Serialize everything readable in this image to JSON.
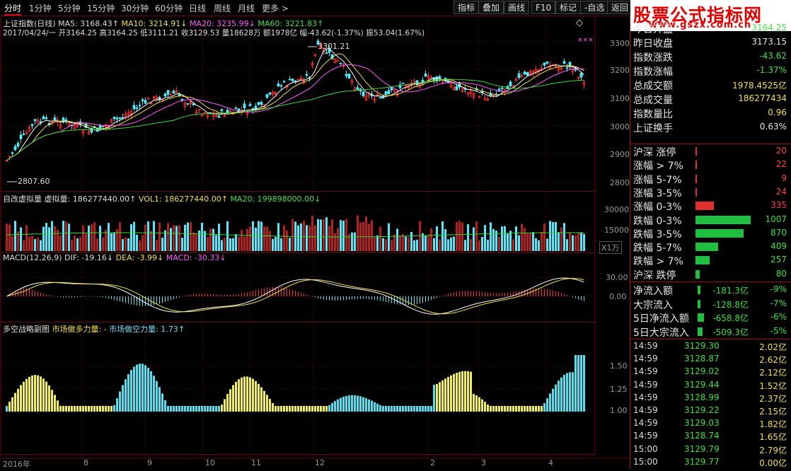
{
  "toolbar": {
    "tabs": [
      "分时",
      "1分钟",
      "5分钟",
      "15分钟",
      "30分钟",
      "60分钟",
      "日线",
      "周线",
      "月线",
      "更多 >"
    ],
    "buttons": [
      "指标",
      "叠加",
      "画线",
      "F10",
      "标记",
      "-自选",
      "返回"
    ]
  },
  "logo": {
    "line1": "股票公式指标网",
    "line2": "www.gszx.com.cn"
  },
  "main": {
    "title": "上证指数(日线)",
    "ma5": "MA5: 3168.43↑",
    "ma10": "MA10: 3214.91↓",
    "ma20": "MA20: 3235.99↓",
    "ma60": "MA60: 3221.83↑",
    "ohlc": "2017/04/24/一 开3164.25 高3164.25 低3111.21 收3129.53 量18628万 额1978亿 幅-43.62(-1.37%) 振53.04(1.67%)",
    "high_label": "3301.21",
    "low_label": "2807.60",
    "y_ticks": [
      "3300",
      "3200",
      "3100",
      "3000",
      "2900",
      "2800"
    ],
    "xxx": "×××"
  },
  "volume": {
    "title": "自改虚拟量",
    "v1": "虚拟量: 186277440.00↑",
    "v2": "VOL1: 186277440.00↑",
    "v3": "MA20: 199898000.00↓",
    "y_ticks": [
      "30000",
      "15000"
    ],
    "unit": "X1万"
  },
  "macd": {
    "title": "MACD(12,26,9)",
    "dif": "DIF: -19.16↓",
    "dea": "DEA: -3.99↓",
    "macd": "MACD: -30.33↓",
    "y_ticks": [
      "30.00",
      "0.00"
    ]
  },
  "strategy": {
    "title": "多空战略副图",
    "bull": "市场做多力量: -",
    "bear": "市场做空力量: 1.73↑",
    "y_ticks": [
      "1.50",
      "1.25",
      "1.00"
    ]
  },
  "x_labels": [
    "2016年",
    "8",
    "9",
    "10",
    "11",
    "12",
    "2",
    "3",
    "4"
  ],
  "quote": {
    "rows": [
      {
        "label": "今日开盘",
        "value": "3164.25",
        "color": "#4be04b"
      },
      {
        "label": "昨日收盘",
        "value": "3173.15",
        "color": "#e8e8e8"
      },
      {
        "label": "指数涨跌",
        "value": "-43.62",
        "color": "#4be04b"
      },
      {
        "label": "指数涨幅",
        "value": "-1.37%",
        "color": "#4be04b"
      },
      {
        "label": "总成交额",
        "value": "1978.4525亿",
        "color": "#f0e050"
      },
      {
        "label": "总成交量",
        "value": "186277434",
        "color": "#f0e050"
      },
      {
        "label": "指数量比",
        "value": "0.96",
        "color": "#f0e050"
      },
      {
        "label": "上证换手",
        "value": "0.63%",
        "color": "#e8e8e8"
      }
    ]
  },
  "breadth": [
    {
      "label": "沪深 涨停",
      "value": "20",
      "color": "#e03030",
      "bar": 1
    },
    {
      "label": "涨幅 > 7%",
      "value": "22",
      "color": "#e03030",
      "bar": 1
    },
    {
      "label": "涨幅 5-7%",
      "value": "9",
      "color": "#e03030",
      "bar": 1
    },
    {
      "label": "涨幅 3-5%",
      "value": "24",
      "color": "#e03030",
      "bar": 1
    },
    {
      "label": "涨幅 0-3%",
      "value": "335",
      "color": "#e03030",
      "bar": 26
    },
    {
      "label": "跌幅 0-3%",
      "value": "1007",
      "color": "#1fc040",
      "bar": 78
    },
    {
      "label": "跌幅 3-5%",
      "value": "870",
      "color": "#1fc040",
      "bar": 68
    },
    {
      "label": "跌幅 5-7%",
      "value": "409",
      "color": "#1fc040",
      "bar": 32
    },
    {
      "label": "跌幅 > 7%",
      "value": "257",
      "color": "#1fc040",
      "bar": 20
    },
    {
      "label": "沪深 跌停",
      "value": "80",
      "color": "#1fc040",
      "bar": 6
    }
  ],
  "flows": [
    {
      "label": "净流入额",
      "value": "-181.3亿",
      "pct": "-9%",
      "bar": 6
    },
    {
      "label": "大宗流入",
      "value": "-128.8亿",
      "pct": "-7%",
      "bar": 5
    },
    {
      "label": "5日净流入额",
      "value": "-658.8亿",
      "pct": "-6%",
      "bar": 26
    },
    {
      "label": "5日大宗流入",
      "value": "-509.3亿",
      "pct": "-5%",
      "bar": 20
    }
  ],
  "ticks": [
    {
      "time": "14:59",
      "price": "3129.30",
      "vol": "2.02亿"
    },
    {
      "time": "14:59",
      "price": "3128.87",
      "vol": "2.62亿"
    },
    {
      "time": "14:59",
      "price": "3129.02",
      "vol": "2.12亿"
    },
    {
      "time": "14:59",
      "price": "3129.44",
      "vol": "1.52亿"
    },
    {
      "time": "14:59",
      "price": "3128.99",
      "vol": "2.37亿"
    },
    {
      "time": "14:59",
      "price": "3129.22",
      "vol": "2.15亿"
    },
    {
      "time": "14:59",
      "price": "3129.03",
      "vol": "1.82亿"
    },
    {
      "time": "14:59",
      "price": "3128.74",
      "vol": "1.65亿"
    },
    {
      "time": "15:00",
      "price": "3129.79",
      "vol": "2.79亿"
    },
    {
      "time": "15:00",
      "price": "3129.77",
      "vol": "0.00亿"
    }
  ],
  "colors": {
    "up": "#ff3030",
    "down": "#54e8f8",
    "ma5": "#ffffff",
    "ma10": "#f0e050",
    "ma20": "#ff5dff",
    "ma60": "#3cd83c",
    "grid": "#6a0a0a"
  }
}
